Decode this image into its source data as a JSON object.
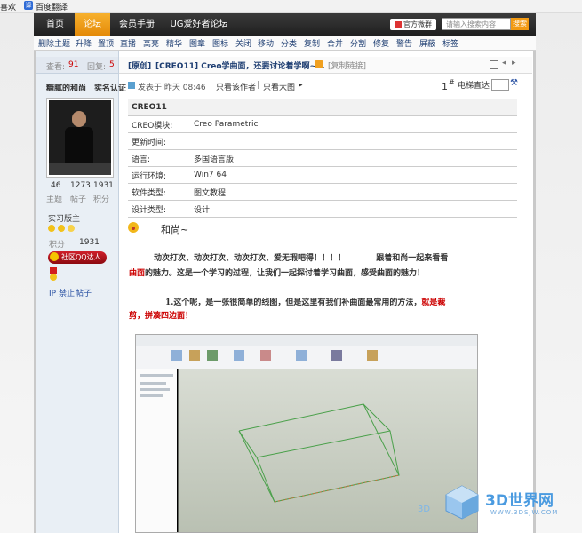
{
  "browser": {
    "bookmark_left": "喜欢",
    "translate_label": "百度翻译",
    "translate_icon": "译"
  },
  "nav": {
    "items": [
      "首页",
      "论坛",
      "会员手册",
      "UG爱好者论坛"
    ],
    "active_index": 1,
    "brand_badge": "官方微群",
    "search_placeholder": "请输入搜索内容",
    "search_button": "搜索"
  },
  "toolbar": {
    "items": [
      "删除主题",
      "升降",
      "置顶",
      "直播",
      "高亮",
      "精华",
      "图章",
      "图标",
      "关闭",
      "移动",
      "分类",
      "复制",
      "合并",
      "分割",
      "修复",
      "警告",
      "屏蔽",
      "标签"
    ]
  },
  "thread": {
    "views_label": "查看:",
    "views": "91",
    "replies_label": "回复:",
    "replies": "5",
    "tag": "[原创]",
    "title": "[CREO11] Creo学曲面，还要讨论着学啊~1.",
    "copy_link": "[复制链接]"
  },
  "author": {
    "name": "糖腻的和尚",
    "verified": "实名认证",
    "stat_values": [
      "46",
      "1273",
      "1931"
    ],
    "stat_labels": [
      "主题",
      "帖子",
      "积分"
    ],
    "rank": "实习版主",
    "points_label": "积分",
    "points": "1931",
    "qq_badge": "社区QQ达人",
    "ip_ban": "IP 禁止",
    "posts": "帖子"
  },
  "post": {
    "posted_at": "发表于 昨天 08:46",
    "only_author": "只看该作者",
    "large_image": "只看大图",
    "floor": "1",
    "floor_suffix": "#",
    "elevator": "电梯直达"
  },
  "info_table": {
    "header": "CREO11",
    "rows": [
      {
        "label": "CREO模块:",
        "value": "Creo Parametric"
      },
      {
        "label": "更新时间:",
        "value": ""
      },
      {
        "label": "语言:",
        "value": "多国语言版"
      },
      {
        "label": "运行环境:",
        "value": "Win7 64"
      },
      {
        "label": "软件类型:",
        "value": "图文教程"
      },
      {
        "label": "设计类型:",
        "value": "设计"
      }
    ]
  },
  "content": {
    "greeting": "和尚~",
    "para1_a": "动次打次、动次打次、动次打次、爱无瑕吧得！！！！",
    "para1_b": "跟着和尚一起来看看",
    "para1_c": "曲面",
    "para1_d": "的魅力。这是一个学习的过程，让我们一起探讨着学习曲面，感受曲面的魅力！",
    "para2_a": "1.这个呢，是一张很简单的线图，但是这里有我们补曲面最常用的方法，",
    "para2_b": "就是裁",
    "para2_c": "剪，拼凑四边面！"
  },
  "watermark": {
    "brand": "3D世界网",
    "url": "WWW.3DSJW.COM",
    "small": "3D"
  },
  "colors": {
    "nav_bg": "#2a2a2a",
    "nav_active": "#f0a020",
    "link_blue": "#1e3e72",
    "accent_red": "#cc0000"
  }
}
